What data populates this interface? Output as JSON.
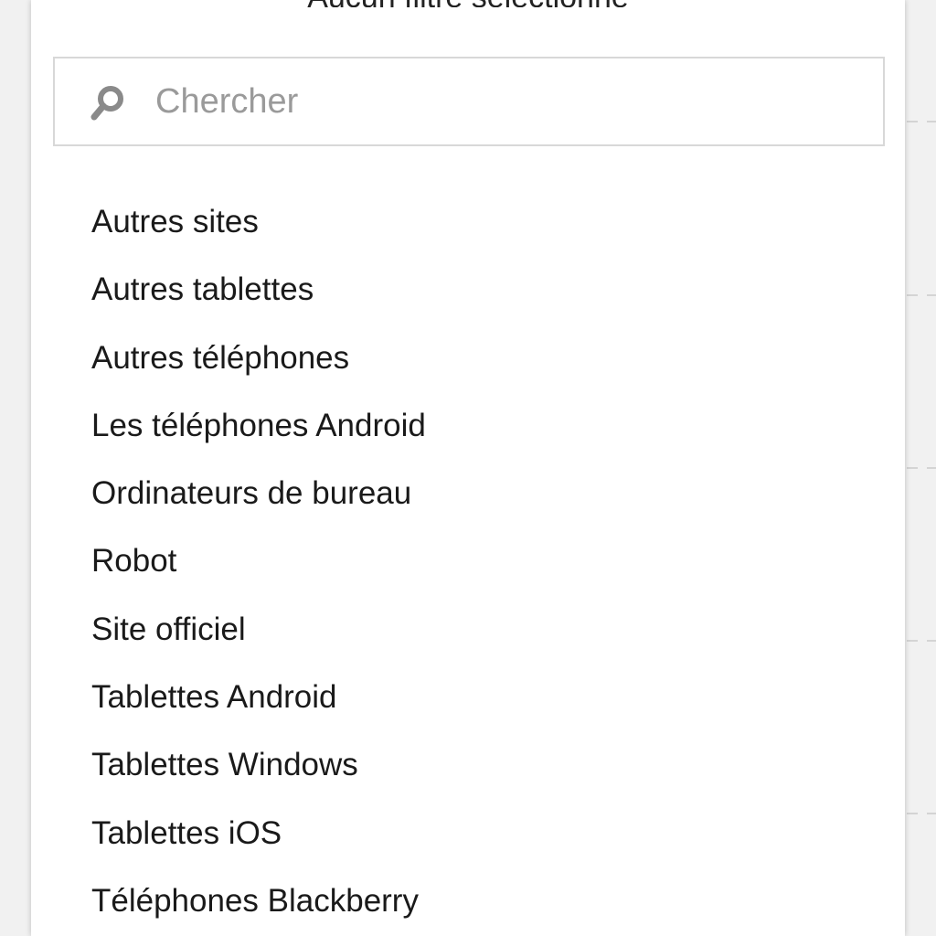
{
  "dialog": {
    "title": "Aucun filtre sélectionné"
  },
  "search": {
    "placeholder": "Chercher",
    "value": "",
    "icon": "search-icon"
  },
  "list": {
    "items": [
      {
        "label": "Autres sites"
      },
      {
        "label": "Autres tablettes"
      },
      {
        "label": "Autres téléphones"
      },
      {
        "label": "Les téléphones Android"
      },
      {
        "label": "Ordinateurs de bureau"
      },
      {
        "label": "Robot"
      },
      {
        "label": "Site officiel"
      },
      {
        "label": "Tablettes Android"
      },
      {
        "label": "Tablettes Windows"
      },
      {
        "label": "Tablettes iOS"
      },
      {
        "label": "Téléphones Blackberry"
      }
    ]
  },
  "colors": {
    "backdrop": "#f1f1f1",
    "panel": "#ffffff",
    "text": "#1a1a1a",
    "placeholder": "#9a9a9a",
    "border": "#d8d8d8",
    "icon": "#8a8a8a"
  }
}
